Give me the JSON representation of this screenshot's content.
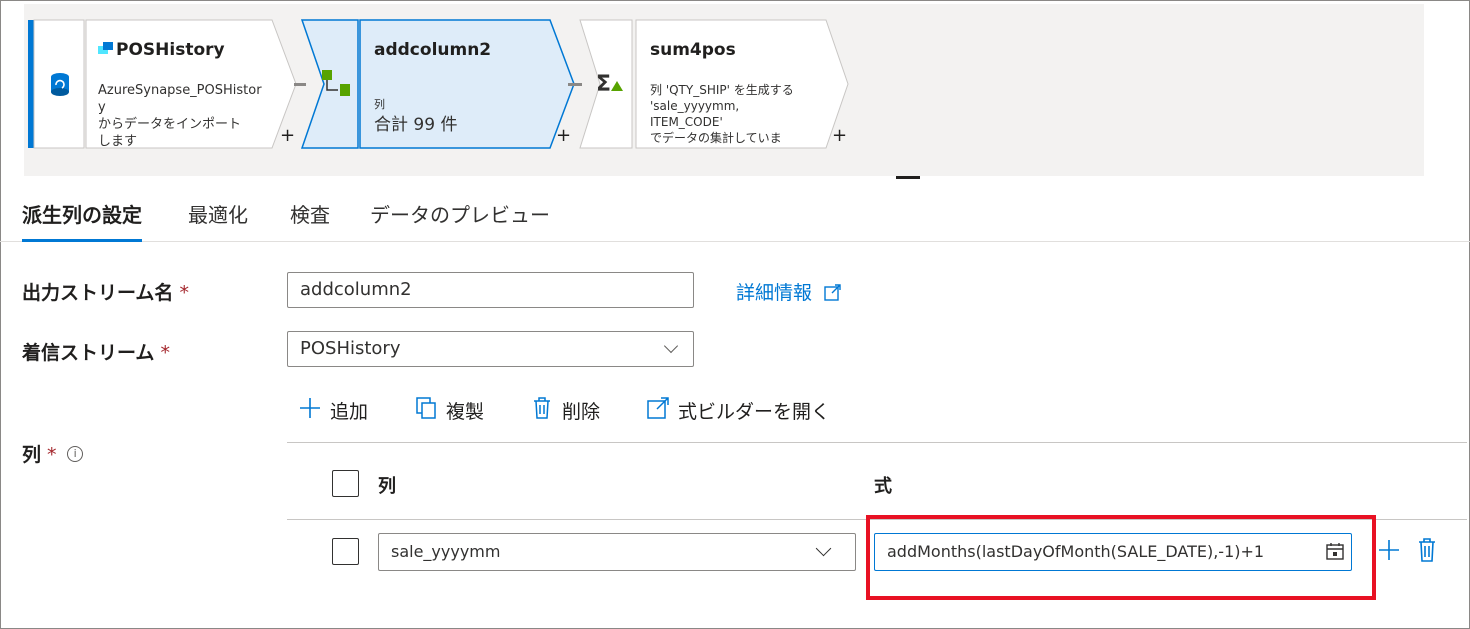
{
  "pipeline": {
    "nodes": [
      {
        "title": "POSHistory",
        "desc_line1": "AzureSynapse_POSHistor",
        "desc_line2": "y",
        "desc_line3": "からデータをインポート",
        "desc_line4": "します",
        "icon": "database-icon"
      },
      {
        "title": "addcolumn2",
        "small_label": "列",
        "summary": "合計 99 件",
        "icon": "derived-column-icon"
      },
      {
        "title": "sum4pos",
        "desc_line1": "列 'QTY_SHIP' を生成する",
        "desc_line2": "'sale_yyyymm,",
        "desc_line3": "ITEM_CODE'",
        "desc_line4": "でデータの集計していま",
        "icon": "aggregate-icon"
      }
    ],
    "add_symbol": "+"
  },
  "tabs": [
    "派生列の設定",
    "最適化",
    "検査",
    "データのプレビュー"
  ],
  "form": {
    "output_stream_label": "出力ストリーム名",
    "output_stream_value": "addcolumn2",
    "required_mark": "*",
    "details_link": "詳細情報",
    "incoming_stream_label": "着信ストリーム",
    "incoming_stream_value": "POSHistory",
    "columns_label": "列",
    "info_icon_text": "i"
  },
  "toolbar": {
    "add": "追加",
    "duplicate": "複製",
    "delete": "削除",
    "open_builder": "式ビルダーを開く"
  },
  "grid": {
    "header_column": "列",
    "header_expression": "式",
    "rows": [
      {
        "column": "sale_yyyymm",
        "expression": "addMonths(lastDayOfMonth(SALE_DATE),-1)+1"
      }
    ]
  },
  "colors": {
    "accent": "#0078d4",
    "highlight": "#e81123",
    "node_selected": "#deecf9"
  }
}
